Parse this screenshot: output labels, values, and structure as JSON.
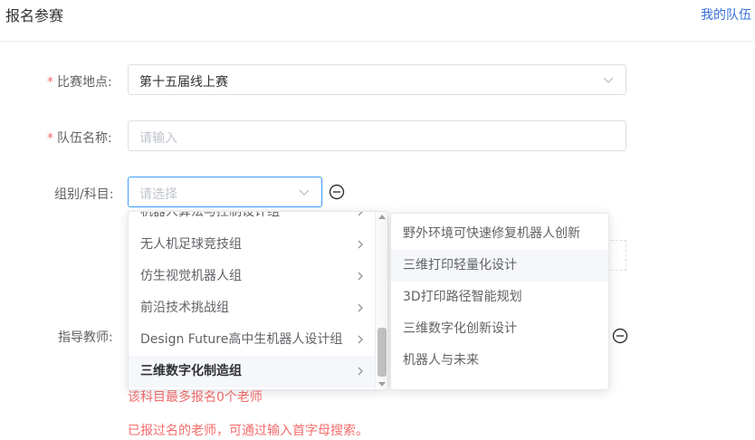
{
  "header": {
    "title": "报名参赛",
    "my_team_link": "我的队伍"
  },
  "form": {
    "required_mark": "*",
    "venue_label": "比赛地点:",
    "venue_value": "第十五届线上赛",
    "team_name_label": "队伍名称:",
    "team_name_placeholder": "请输入",
    "group_label": "组别/科目:",
    "group_placeholder": "请选择",
    "teacher_label": "指导教师:",
    "teacher_limit_hint": "该科目最多报名0个老师",
    "teacher_search_hint": "已报过名的老师，可通过输入首字母搜索。"
  },
  "cascader": {
    "level1": [
      {
        "label": "机器人算法与控制设计组",
        "active": false
      },
      {
        "label": "无人机足球竞技组",
        "active": false
      },
      {
        "label": "仿生视觉机器人组",
        "active": false
      },
      {
        "label": "前沿技术挑战组",
        "active": false
      },
      {
        "label": "Design Future高中生机器人设计组",
        "active": false
      },
      {
        "label": "三维数字化制造组",
        "active": true
      }
    ],
    "level2": [
      {
        "label": "野外环境可快速修复机器人创新",
        "hover": false
      },
      {
        "label": "三维打印轻量化设计",
        "hover": true
      },
      {
        "label": "3D打印路径智能规划",
        "hover": false
      },
      {
        "label": "三维数字化创新设计",
        "hover": false
      },
      {
        "label": "机器人与未来",
        "hover": false
      }
    ]
  },
  "colors": {
    "accent": "#409eff",
    "link": "#3a6fd8",
    "danger": "#f56c6c"
  }
}
